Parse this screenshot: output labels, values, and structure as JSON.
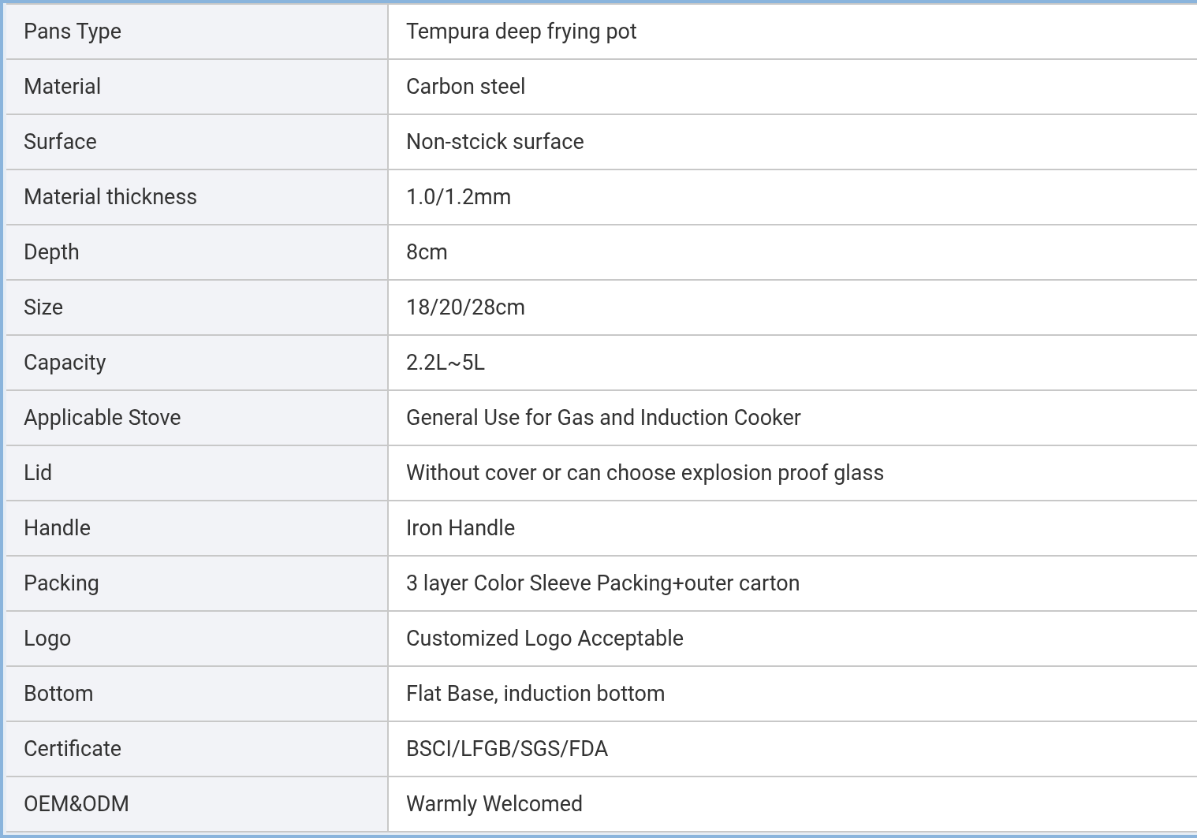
{
  "table": {
    "rows": [
      {
        "label": "Pans Type",
        "value": "Tempura deep frying pot"
      },
      {
        "label": "Material",
        "value": "Carbon steel"
      },
      {
        "label": "Surface",
        "value": "Non-stcick surface"
      },
      {
        "label": "Material thickness",
        "value": "1.0/1.2mm"
      },
      {
        "label": "Depth",
        "value": "8cm"
      },
      {
        "label": "Size",
        "value": "18/20/28cm"
      },
      {
        "label": "Capacity",
        "value": "2.2L~5L"
      },
      {
        "label": "Applicable Stove",
        "value": "General Use for Gas and Induction Cooker"
      },
      {
        "label": "Lid",
        "value": "Without cover or can choose explosion proof glass"
      },
      {
        "label": "Handle",
        "value": "Iron Handle"
      },
      {
        "label": "Packing",
        "value": "3 layer Color Sleeve Packing+outer carton"
      },
      {
        "label": "Logo",
        "value": "Customized Logo Acceptable"
      },
      {
        "label": "Bottom",
        "value": "Flat Base, induction bottom"
      },
      {
        "label": "Certificate",
        "value": "BSCI/LFGB/SGS/FDA"
      },
      {
        "label": "OEM&ODM",
        "value": "Warmly Welcomed"
      }
    ]
  }
}
